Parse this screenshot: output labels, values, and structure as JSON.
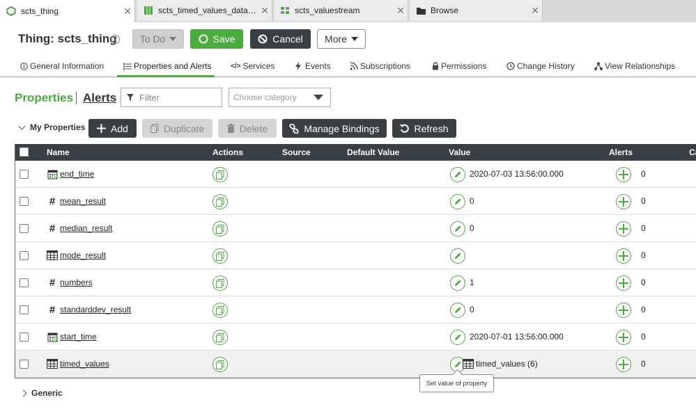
{
  "tabs": [
    {
      "label": "scts_thing",
      "icon": "thing-icon",
      "active": true
    },
    {
      "label": "scts_timed_values_datas...",
      "icon": "datatable-icon",
      "active": false
    },
    {
      "label": "scts_valuestream",
      "icon": "valuestream-icon",
      "active": false
    },
    {
      "label": "Browse",
      "icon": "folder-icon",
      "active": false
    }
  ],
  "header": {
    "title": "Thing: scts_thing",
    "todo_label": "To Do",
    "save_label": "Save",
    "cancel_label": "Cancel",
    "more_label": "More"
  },
  "subnav": [
    {
      "label": "General Information",
      "icon": "info-icon"
    },
    {
      "label": "Properties and Alerts",
      "icon": "list-icon",
      "active": true
    },
    {
      "label": "Services",
      "icon": "code-icon"
    },
    {
      "label": "Events",
      "icon": "lightning-icon"
    },
    {
      "label": "Subscriptions",
      "icon": "subscription-icon"
    },
    {
      "label": "Permissions",
      "icon": "lock-icon"
    },
    {
      "label": "Change History",
      "icon": "clock-icon"
    },
    {
      "label": "View Relationships",
      "icon": "relationships-icon"
    }
  ],
  "section": {
    "properties_label": "Properties",
    "alerts_label": "Alerts",
    "filter_placeholder": "Filter",
    "category_placeholder": "Choose category"
  },
  "toolbar": {
    "group_label": "My Properties",
    "add_label": "Add",
    "duplicate_label": "Duplicate",
    "delete_label": "Delete",
    "bindings_label": "Manage Bindings",
    "refresh_label": "Refresh"
  },
  "grid": {
    "columns": [
      "Name",
      "Actions",
      "Source",
      "Default Value",
      "Value",
      "Alerts",
      "Ca"
    ],
    "rows": [
      {
        "name": "end_time",
        "type": "datetime",
        "value": "2020-07-03 13:56:00.000",
        "alerts": "0"
      },
      {
        "name": "mean_result",
        "type": "number",
        "value": "0",
        "alerts": "0"
      },
      {
        "name": "median_result",
        "type": "number",
        "value": "0",
        "alerts": "0"
      },
      {
        "name": "mode_result",
        "type": "infotable",
        "value": "",
        "alerts": "0"
      },
      {
        "name": "numbers",
        "type": "number",
        "value": "1",
        "alerts": "0"
      },
      {
        "name": "standarddev_result",
        "type": "number",
        "value": "0",
        "alerts": "0"
      },
      {
        "name": "start_time",
        "type": "datetime",
        "value": "2020-07-01 13:56:00.000",
        "alerts": "0"
      },
      {
        "name": "timed_values",
        "type": "infotable",
        "value": "timed_values (6)",
        "alerts": "0",
        "selected": true
      }
    ]
  },
  "tooltip": "Set value of property",
  "generic_label": "Generic",
  "colors": {
    "accent": "#4bab3f",
    "dark": "#3a3f44"
  }
}
